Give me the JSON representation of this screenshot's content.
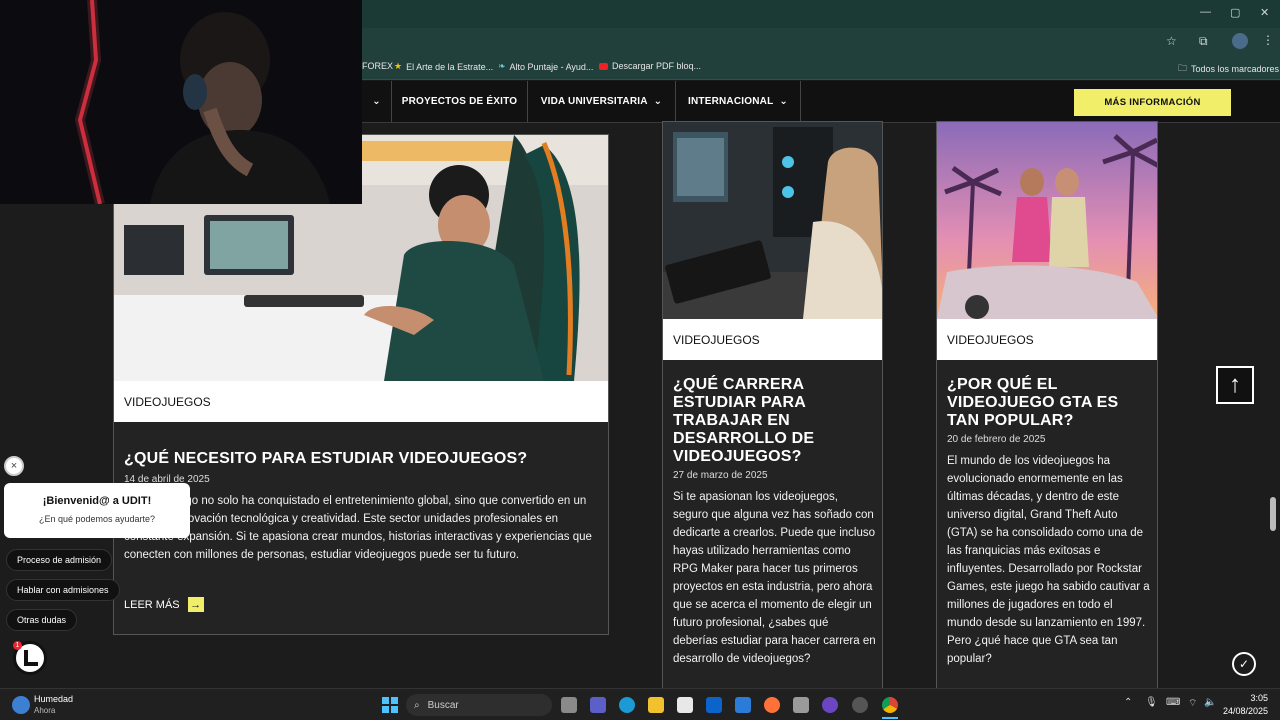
{
  "browser": {
    "bookmarks": [
      {
        "label": "FOREX",
        "icon": "bookmark-folder-icon"
      },
      {
        "label": "El Arte de la Estrate...",
        "icon": "star-icon"
      },
      {
        "label": "Alto Puntaje - Ayud...",
        "icon": "leaf-icon"
      },
      {
        "label": "Descargar PDF bloq...",
        "icon": "youtube-icon"
      }
    ],
    "all_bookmarks": "Todos los marcadores"
  },
  "site_nav": {
    "items": [
      {
        "label": "PROYECTOS DE ÉXITO",
        "has_dropdown": false
      },
      {
        "label": "VIDA UNIVERSITARIA",
        "has_dropdown": true
      },
      {
        "label": "INTERNACIONAL",
        "has_dropdown": true
      }
    ],
    "cta": "MÁS INFORMACIÓN"
  },
  "cards": [
    {
      "tag": "VIDEOJUEGOS",
      "title": "¿QUÉ NECESITO PARA ESTUDIAR VIDEOJUEGOS?",
      "date": "14 de abril de 2025",
      "body": "del videojuego no solo ha conquistado el entretenimiento global, sino que convertido en un motor de innovación tecnológica y creatividad. Este sector unidades profesionales en constante expansión. Si te apasiona crear mundos, historias interactivas y experiencias que conecten con millones de personas, estudiar videojuegos puede ser tu futuro.",
      "read_more": "LEER MÁS"
    },
    {
      "tag": "VIDEOJUEGOS",
      "title": "¿QUÉ CARRERA ESTUDIAR PARA TRABAJAR EN DESARROLLO DE VIDEOJUEGOS?",
      "date": "27 de marzo de 2025",
      "body": "Si te apasionan los videojuegos, seguro que alguna vez has soñado con dedicarte a crearlos. Puede que incluso hayas utilizado herramientas como RPG Maker para hacer tus primeros proyectos en esta industria, pero ahora que se acerca el momento de elegir un futuro profesional, ¿sabes qué deberías estudiar para hacer carrera en desarrollo de videojuegos?"
    },
    {
      "tag": "VIDEOJUEGOS",
      "title": "¿POR QUÉ EL VIDEOJUEGO GTA ES TAN POPULAR?",
      "date": "20 de febrero de 2025",
      "body": "El mundo de los videojuegos ha evolucionado enormemente en las últimas décadas, y dentro de este universo digital, Grand Theft Auto (GTA) se ha consolidado como una de las franquicias más exitosas e influyentes. Desarrollado por Rockstar Games, este juego ha sabido cautivar a millones de jugadores en todo el mundo desde su lanzamiento en 1997. Pero ¿qué hace que GTA sea tan popular?"
    }
  ],
  "chat": {
    "close": "×",
    "greeting": "¡Bienvenid@ a UDIT!",
    "prompt": "¿En qué podemos ayudarte?",
    "options": [
      "Proceso de admisión",
      "Hablar con admisiones",
      "Otras dudas"
    ]
  },
  "taskbar": {
    "weather_title": "Humedad",
    "weather_sub": "Ahora",
    "search_placeholder": "Buscar",
    "time": "3:05",
    "date": "24/08/2025",
    "notification_badge": "1"
  },
  "colors": {
    "accent_yellow": "#f1ee6a",
    "tabstrip": "#1b3a36",
    "toolbar": "#213f3b",
    "page_bg": "#1c1c1c"
  }
}
